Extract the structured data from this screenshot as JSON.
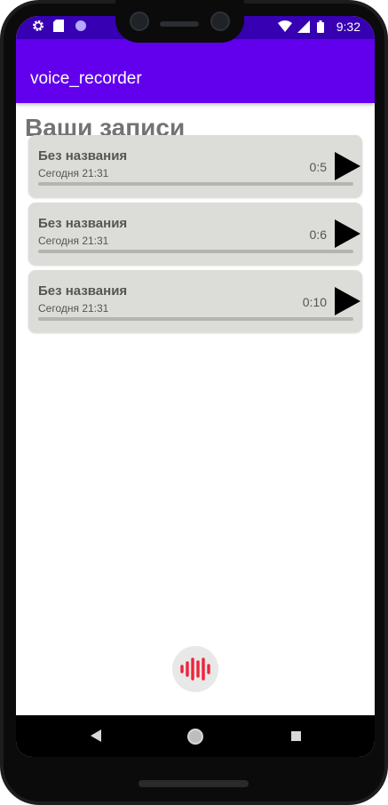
{
  "status_bar": {
    "time": "9:32",
    "icons": [
      "gear-icon",
      "sd-card-icon",
      "circle-icon",
      "wifi-icon",
      "signal-icon",
      "battery-icon"
    ]
  },
  "app_bar": {
    "title": "voice_recorder",
    "color": "#6200ee",
    "status_color": "#3700b3"
  },
  "main": {
    "heading": "Ваши записи",
    "recordings": [
      {
        "title": "Без названия",
        "date": "Сегодня 21:31",
        "duration": "0:5",
        "progress": 0
      },
      {
        "title": "Без названия",
        "date": "Сегодня 21:31",
        "duration": "0:6",
        "progress": 0
      },
      {
        "title": "Без названия",
        "date": "Сегодня 21:31",
        "duration": "0:10",
        "progress": 0
      }
    ]
  },
  "record_button": {
    "icon": "sound-wave-icon",
    "color": "#ef233c"
  },
  "nav": {
    "back": "back-icon",
    "home": "home-icon",
    "recents": "recents-icon"
  }
}
